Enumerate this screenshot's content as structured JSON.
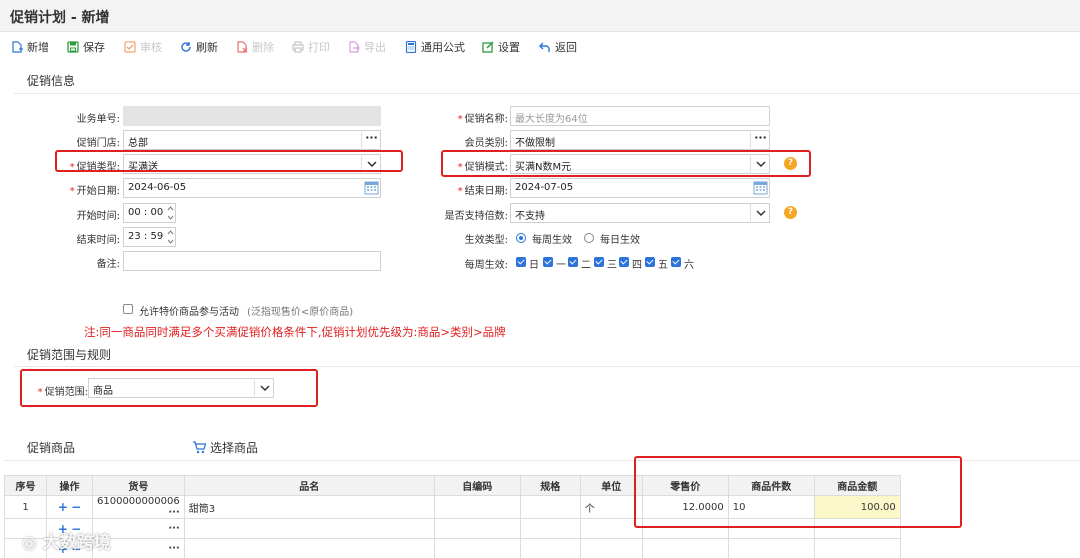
{
  "title": "促销计划 - 新增",
  "toolbar": {
    "new": "新增",
    "save": "保存",
    "audit": "审核",
    "refresh": "刷新",
    "delete": "删除",
    "print": "打印",
    "export": "导出",
    "formula": "通用公式",
    "settings": "设置",
    "back": "返回"
  },
  "sections": {
    "info": "促销信息",
    "scope": "促销范围与规则",
    "products": "促销商品",
    "select_products": "选择商品"
  },
  "form": {
    "business_no": {
      "label": "业务单号:",
      "value": ""
    },
    "promo_name": {
      "label": "促销名称:",
      "placeholder": "最大长度为64位"
    },
    "store": {
      "label": "促销门店:",
      "value": "总部"
    },
    "member_type": {
      "label": "会员类别:",
      "value": "不做限制"
    },
    "promo_type": {
      "label": "促销类型:",
      "value": "买满送"
    },
    "promo_mode": {
      "label": "促销模式:",
      "value": "买满N数M元"
    },
    "start_date": {
      "label": "开始日期:",
      "value": "2024-06-05"
    },
    "end_date": {
      "label": "结束日期:",
      "value": "2024-07-05"
    },
    "start_time": {
      "label": "开始时间:",
      "value": "00 : 00"
    },
    "multiple": {
      "label": "是否支持倍数:",
      "value": "不支持"
    },
    "end_time": {
      "label": "结束时间:",
      "value": "23 : 59"
    },
    "effect_type": {
      "label": "生效类型:",
      "options": [
        "每周生效",
        "每日生效"
      ],
      "selected": "每周生效"
    },
    "remark": {
      "label": "备注:",
      "value": ""
    },
    "weekly": {
      "label": "每周生效:",
      "days": [
        "日",
        "一",
        "二",
        "三",
        "四",
        "五",
        "六"
      ]
    },
    "allow_special": {
      "label": "允许特价商品参与活动",
      "hint": "(泛指现售价<原价商品)",
      "checked": false
    }
  },
  "note": "注:同一商品同时满足多个买满促销价格条件下,促销计划优先级为:商品>类别>品牌",
  "scope": {
    "label": "促销范围:",
    "value": "商品"
  },
  "table": {
    "headers": [
      "序号",
      "操作",
      "货号",
      "品名",
      "自编码",
      "规格",
      "单位",
      "零售价",
      "商品件数",
      "商品金额"
    ],
    "rows": [
      {
        "seq": "1",
        "code": "6100000000006",
        "name": "甜筒3",
        "selfcode": "",
        "spec": "",
        "unit": "个",
        "price": "12.0000",
        "qty": "10",
        "amount": "100.00"
      }
    ]
  },
  "watermark": "大数跨境",
  "colors": {
    "accent": "#2d74da",
    "highlight": "#e02020",
    "help": "#f5a623"
  }
}
